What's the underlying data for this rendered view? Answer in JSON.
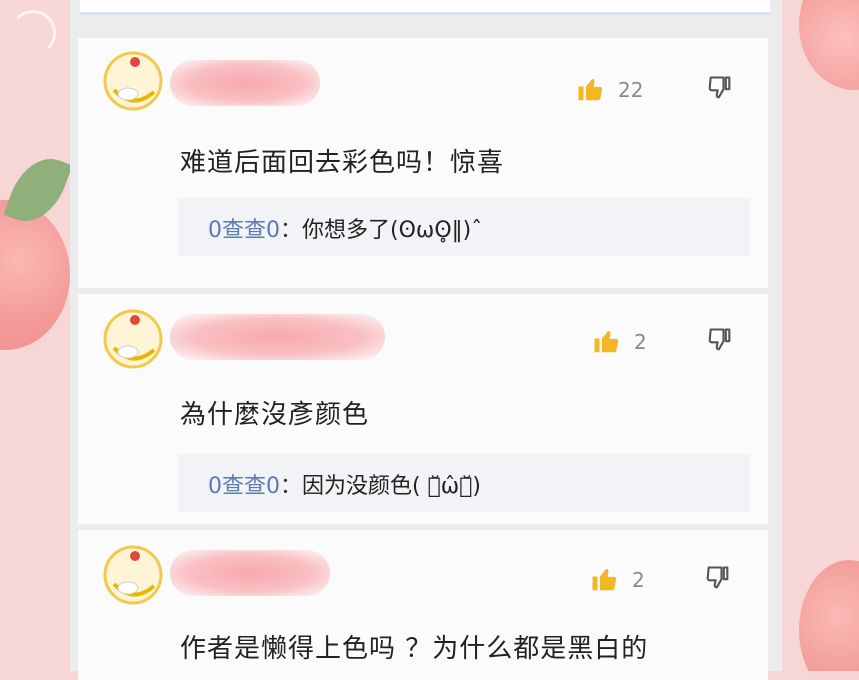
{
  "comments": [
    {
      "likes": "22",
      "text": "难道后面回去彩色吗！惊喜",
      "reply": {
        "author": "0查查0",
        "colon": "：",
        "text": "你想多了(ʘωʘ̥‖)ˆ"
      }
    },
    {
      "likes": "2",
      "text": "為什麼沒彥颜色",
      "reply": {
        "author": "0查查0",
        "colon": "：",
        "text": "因为没颜色( ･̆ω̂･̆)"
      }
    },
    {
      "likes": "2",
      "text": "作者是懒得上色吗 ？为什么都是黑白的"
    }
  ],
  "colors": {
    "like_icon": "#f4b623",
    "reply_author": "#5b7cb1",
    "name_blur": "#f7a9ae"
  },
  "icons": {
    "like": "thumbs-up-icon",
    "dislike": "thumbs-down-icon",
    "avatar": "chick-avatar-icon"
  }
}
